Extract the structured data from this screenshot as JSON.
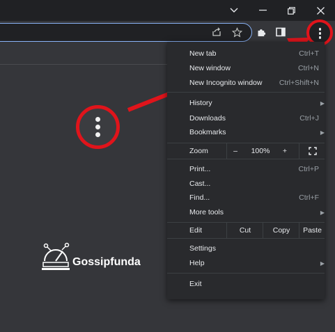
{
  "window_controls": {
    "dropdown_icon": "chevron-down-icon",
    "minimize_icon": "minimize-icon",
    "restore_icon": "restore-icon",
    "close_icon": "close-icon"
  },
  "toolbar": {
    "share_icon": "share-icon",
    "bookmark_icon": "star-icon",
    "extensions_icon": "puzzle-icon",
    "sidepanel_icon": "side-panel-icon",
    "menu_icon": "kebab-menu-icon"
  },
  "menu": {
    "new_tab": {
      "label": "New tab",
      "shortcut": "Ctrl+T"
    },
    "new_window": {
      "label": "New window",
      "shortcut": "Ctrl+N"
    },
    "new_incognito": {
      "label": "New Incognito window",
      "shortcut": "Ctrl+Shift+N"
    },
    "history": {
      "label": "History"
    },
    "downloads": {
      "label": "Downloads",
      "shortcut": "Ctrl+J"
    },
    "bookmarks": {
      "label": "Bookmarks"
    },
    "zoom": {
      "label": "Zoom",
      "minus": "–",
      "value": "100%",
      "plus": "+"
    },
    "print": {
      "label": "Print...",
      "shortcut": "Ctrl+P"
    },
    "cast": {
      "label": "Cast..."
    },
    "find": {
      "label": "Find...",
      "shortcut": "Ctrl+F"
    },
    "more_tools": {
      "label": "More tools"
    },
    "edit": {
      "label": "Edit",
      "cut": "Cut",
      "copy": "Copy",
      "paste": "Paste"
    },
    "settings": {
      "label": "Settings"
    },
    "help": {
      "label": "Help"
    },
    "exit": {
      "label": "Exit"
    }
  },
  "watermark": {
    "text": "Gossipfunda"
  },
  "colors": {
    "annotation": "#e0141b",
    "menu_bg": "#292a2d",
    "focus_ring": "#8ab4f8"
  }
}
